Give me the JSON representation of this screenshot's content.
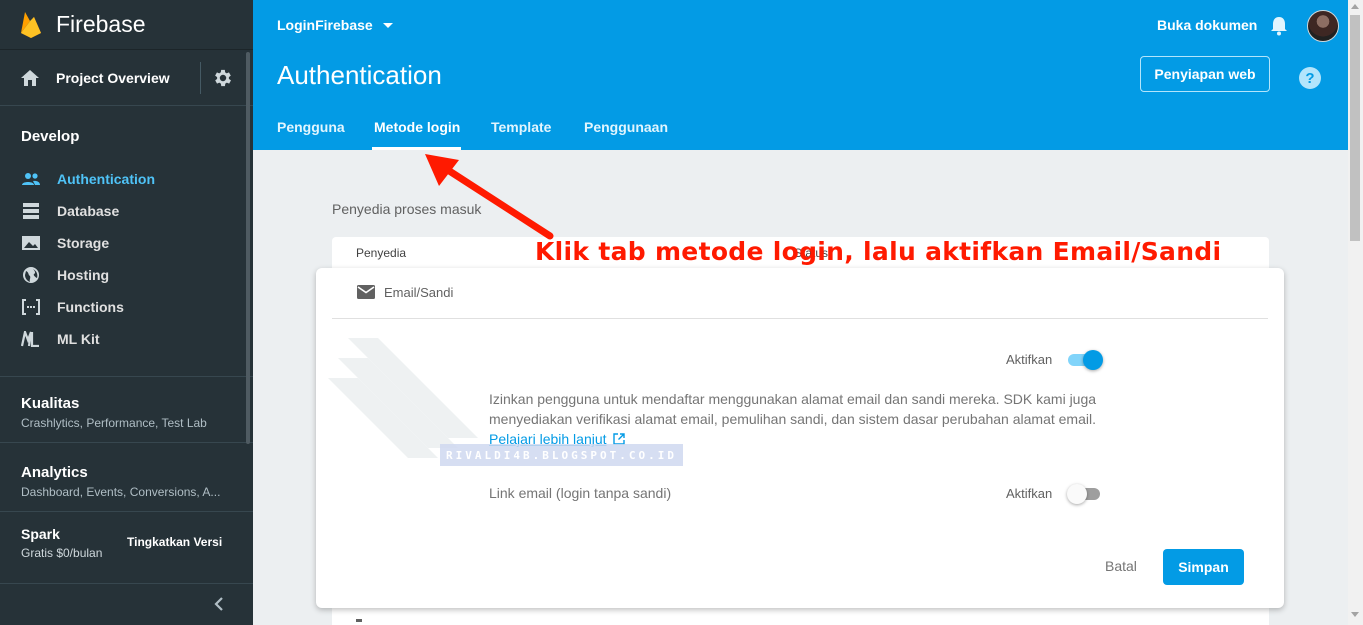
{
  "sidebar": {
    "brand": "Firebase",
    "project_overview": "Project Overview",
    "develop_title": "Develop",
    "develop_items": [
      {
        "label": "Authentication",
        "icon": "people-icon"
      },
      {
        "label": "Database",
        "icon": "database-icon"
      },
      {
        "label": "Storage",
        "icon": "image-icon"
      },
      {
        "label": "Hosting",
        "icon": "globe-icon"
      },
      {
        "label": "Functions",
        "icon": "functions-icon"
      },
      {
        "label": "ML Kit",
        "icon": "mlkit-icon"
      }
    ],
    "quality": {
      "title": "Kualitas",
      "subtitle": "Crashlytics, Performance, Test Lab"
    },
    "analytics": {
      "title": "Analytics",
      "subtitle": "Dashboard, Events, Conversions, A..."
    },
    "plan": {
      "name": "Spark",
      "price": "Gratis $0/bulan",
      "upgrade": "Tingkatkan Versi"
    }
  },
  "header": {
    "project": "LoginFirebase",
    "docs": "Buka dokumen",
    "title": "Authentication",
    "setup_button": "Penyiapan web",
    "help": "?",
    "tabs": [
      "Pengguna",
      "Metode login",
      "Template",
      "Penggunaan"
    ],
    "active_tab": "Metode login"
  },
  "main": {
    "providers_label": "Penyedia proses masuk",
    "table_headers": [
      "Penyedia",
      "Status"
    ]
  },
  "dialog": {
    "provider": "Email/Sandi",
    "enable_label": "Aktifkan",
    "enabled": true,
    "description": "Izinkan pengguna untuk mendaftar menggunakan alamat email dan sandi mereka. SDK kami juga menyediakan verifikasi alamat email, pemulihan sandi, dan sistem dasar perubahan alamat email.",
    "learn_more": "Pelajari lebih lanjut",
    "email_link_label": "Link email (login tanpa sandi)",
    "email_link_enable_label": "Aktifkan",
    "email_link_enabled": false,
    "cancel": "Batal",
    "save": "Simpan"
  },
  "annotation": {
    "text": "Klik tab metode login, lalu aktifkan Email/Sandi",
    "color": "#ff1a00"
  },
  "watermark": "RIVALDI4B.BLOGSPOT.CO.ID",
  "colors": {
    "primary": "#039be5",
    "sidebar": "#263238",
    "active_nav": "#4fc3f7"
  }
}
